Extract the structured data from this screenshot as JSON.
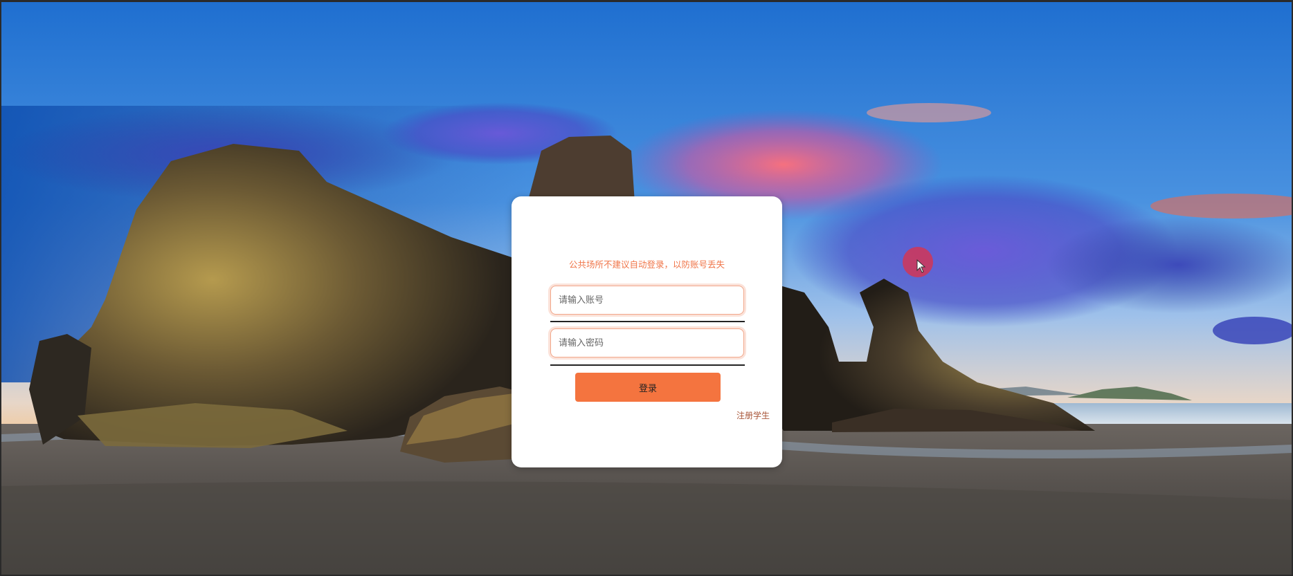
{
  "login": {
    "notice": "公共场所不建议自动登录，以防账号丢失",
    "username_placeholder": "请输入账号",
    "password_placeholder": "请输入密码",
    "submit_label": "登录",
    "register_label": "注册学生"
  },
  "colors": {
    "accent": "#f4743f",
    "notice_text": "#f0764a",
    "register_text": "#a85538",
    "card_background": "#ffffff"
  },
  "background": {
    "scene": "coastal sunset with sea stacks on a beach"
  },
  "cursor": {
    "icon": "cursor-arrow-icon",
    "highlight_color": "#d63452"
  }
}
